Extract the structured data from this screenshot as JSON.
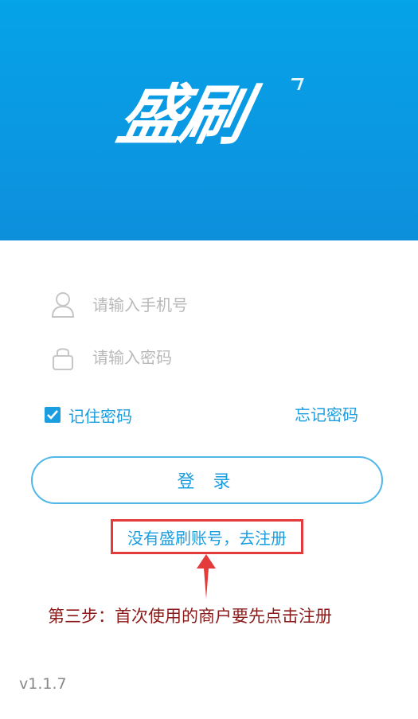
{
  "header": {
    "logo_text": "盛刷",
    "background_color": "#0b97e2"
  },
  "form": {
    "phone_placeholder": "请输入手机号",
    "phone_value": "",
    "password_placeholder": "请输入密码",
    "password_value": "",
    "remember_label": "记住密码",
    "remember_checked": true,
    "forgot_label": "忘记密码",
    "login_label": "登 录",
    "register_label": "没有盛刷账号，去注册"
  },
  "annotation": {
    "text": "第三步：首次使用的商户要先点击注册",
    "highlight_color": "#e33b3b"
  },
  "footer": {
    "version": "v1.1.7"
  },
  "icons": {
    "phone_field": "user-icon",
    "password_field": "lock-icon",
    "remember": "checkbox-checked-icon"
  },
  "colors": {
    "accent": "#1a9ee0",
    "placeholder": "#b9b9b9"
  }
}
